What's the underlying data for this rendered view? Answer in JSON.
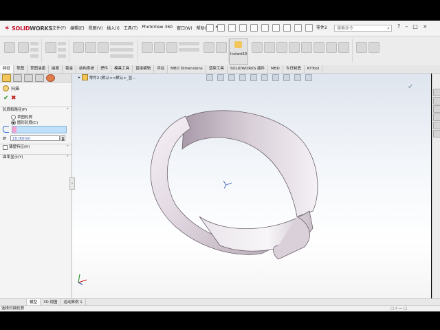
{
  "app": {
    "logo_prefix": "DS",
    "logo_solid": "SOLID",
    "logo_works": "WORKS",
    "brand_color": "#c8102e",
    "doc_name": "零件2",
    "search_placeholder": "搜索命令"
  },
  "menu": [
    "文件(F)",
    "编辑(E)",
    "视图(V)",
    "插入(I)",
    "工具(T)",
    "PhotoView 360",
    "窗口(W)",
    "帮助(H)"
  ],
  "ribbon": {
    "instant3d_label": "Instant3D"
  },
  "tabs": {
    "items": [
      "特征",
      "草图",
      "草图油墨",
      "曲面",
      "钣金",
      "结构系统",
      "焊件",
      "模具工具",
      "直接编辑",
      "评估",
      "MBD Dimensions",
      "渲染工具",
      "SOLIDWORKS 插件",
      "MBD",
      "今日制造",
      "KYTool"
    ],
    "active_index": 0
  },
  "property_manager": {
    "title": "扫描",
    "section_profile": "轮廓和路径(P)",
    "radio_sketch": "草图轮廓",
    "radio_circular": "圆形轮廓(C)",
    "diameter_value": "10.00mm",
    "checkbox_thin": "薄壁特征(H)",
    "section_curvature": "曲率显示(Y)"
  },
  "viewport": {
    "breadcrumb": "零件2 (默认<<默认>_显..."
  },
  "bottom_tabs": {
    "items": [
      "模型",
      "3D 视图",
      "运动算例 1"
    ],
    "active_index": 0
  },
  "status": {
    "text": "选择扫描轮廓"
  }
}
